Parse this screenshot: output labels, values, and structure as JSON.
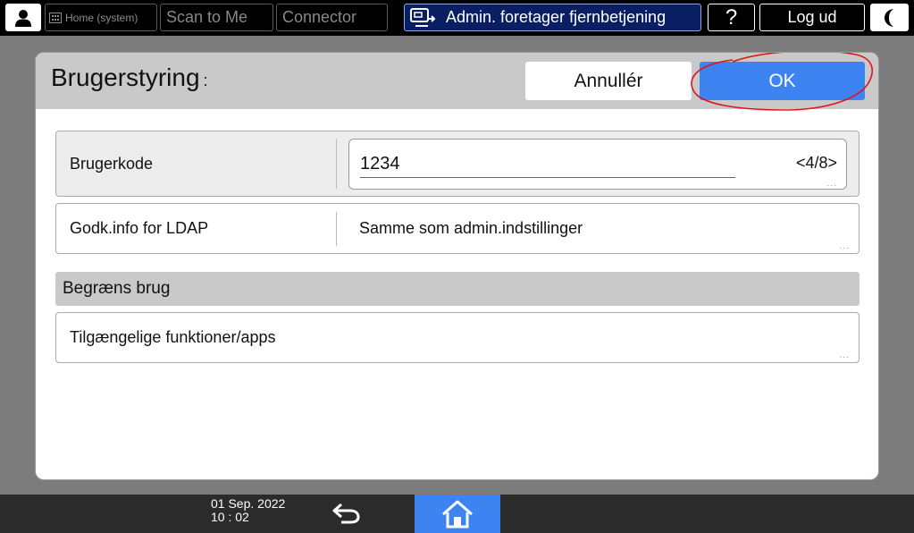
{
  "topbar": {
    "home_label": "Home (system)",
    "scan_label": "Scan to Me",
    "connector_label": "Connector",
    "admin_label": "Admin. foretager fjernbetjening",
    "help_label": "?",
    "logout_label": "Log ud"
  },
  "dialog": {
    "title": "Brugerstyring",
    "title_suffix": ":",
    "cancel_label": "Annullér",
    "ok_label": "OK",
    "rows": {
      "user_code": {
        "label": "Brugerkode",
        "value": "1234",
        "counter": "<4/8>"
      },
      "ldap": {
        "label": "Godk.info for LDAP",
        "value": "Samme som admin.indstillinger"
      },
      "apps": {
        "label": "Tilgængelige funktioner/apps"
      }
    },
    "section_label": "Begræns brug",
    "more_dots": "..."
  },
  "bottombar": {
    "date": "01 Sep. 2022",
    "time": "10 : 02"
  },
  "colors": {
    "accent": "#3e83f2",
    "admin_bg": "#0a1f63",
    "annotation": "#e0141e"
  }
}
